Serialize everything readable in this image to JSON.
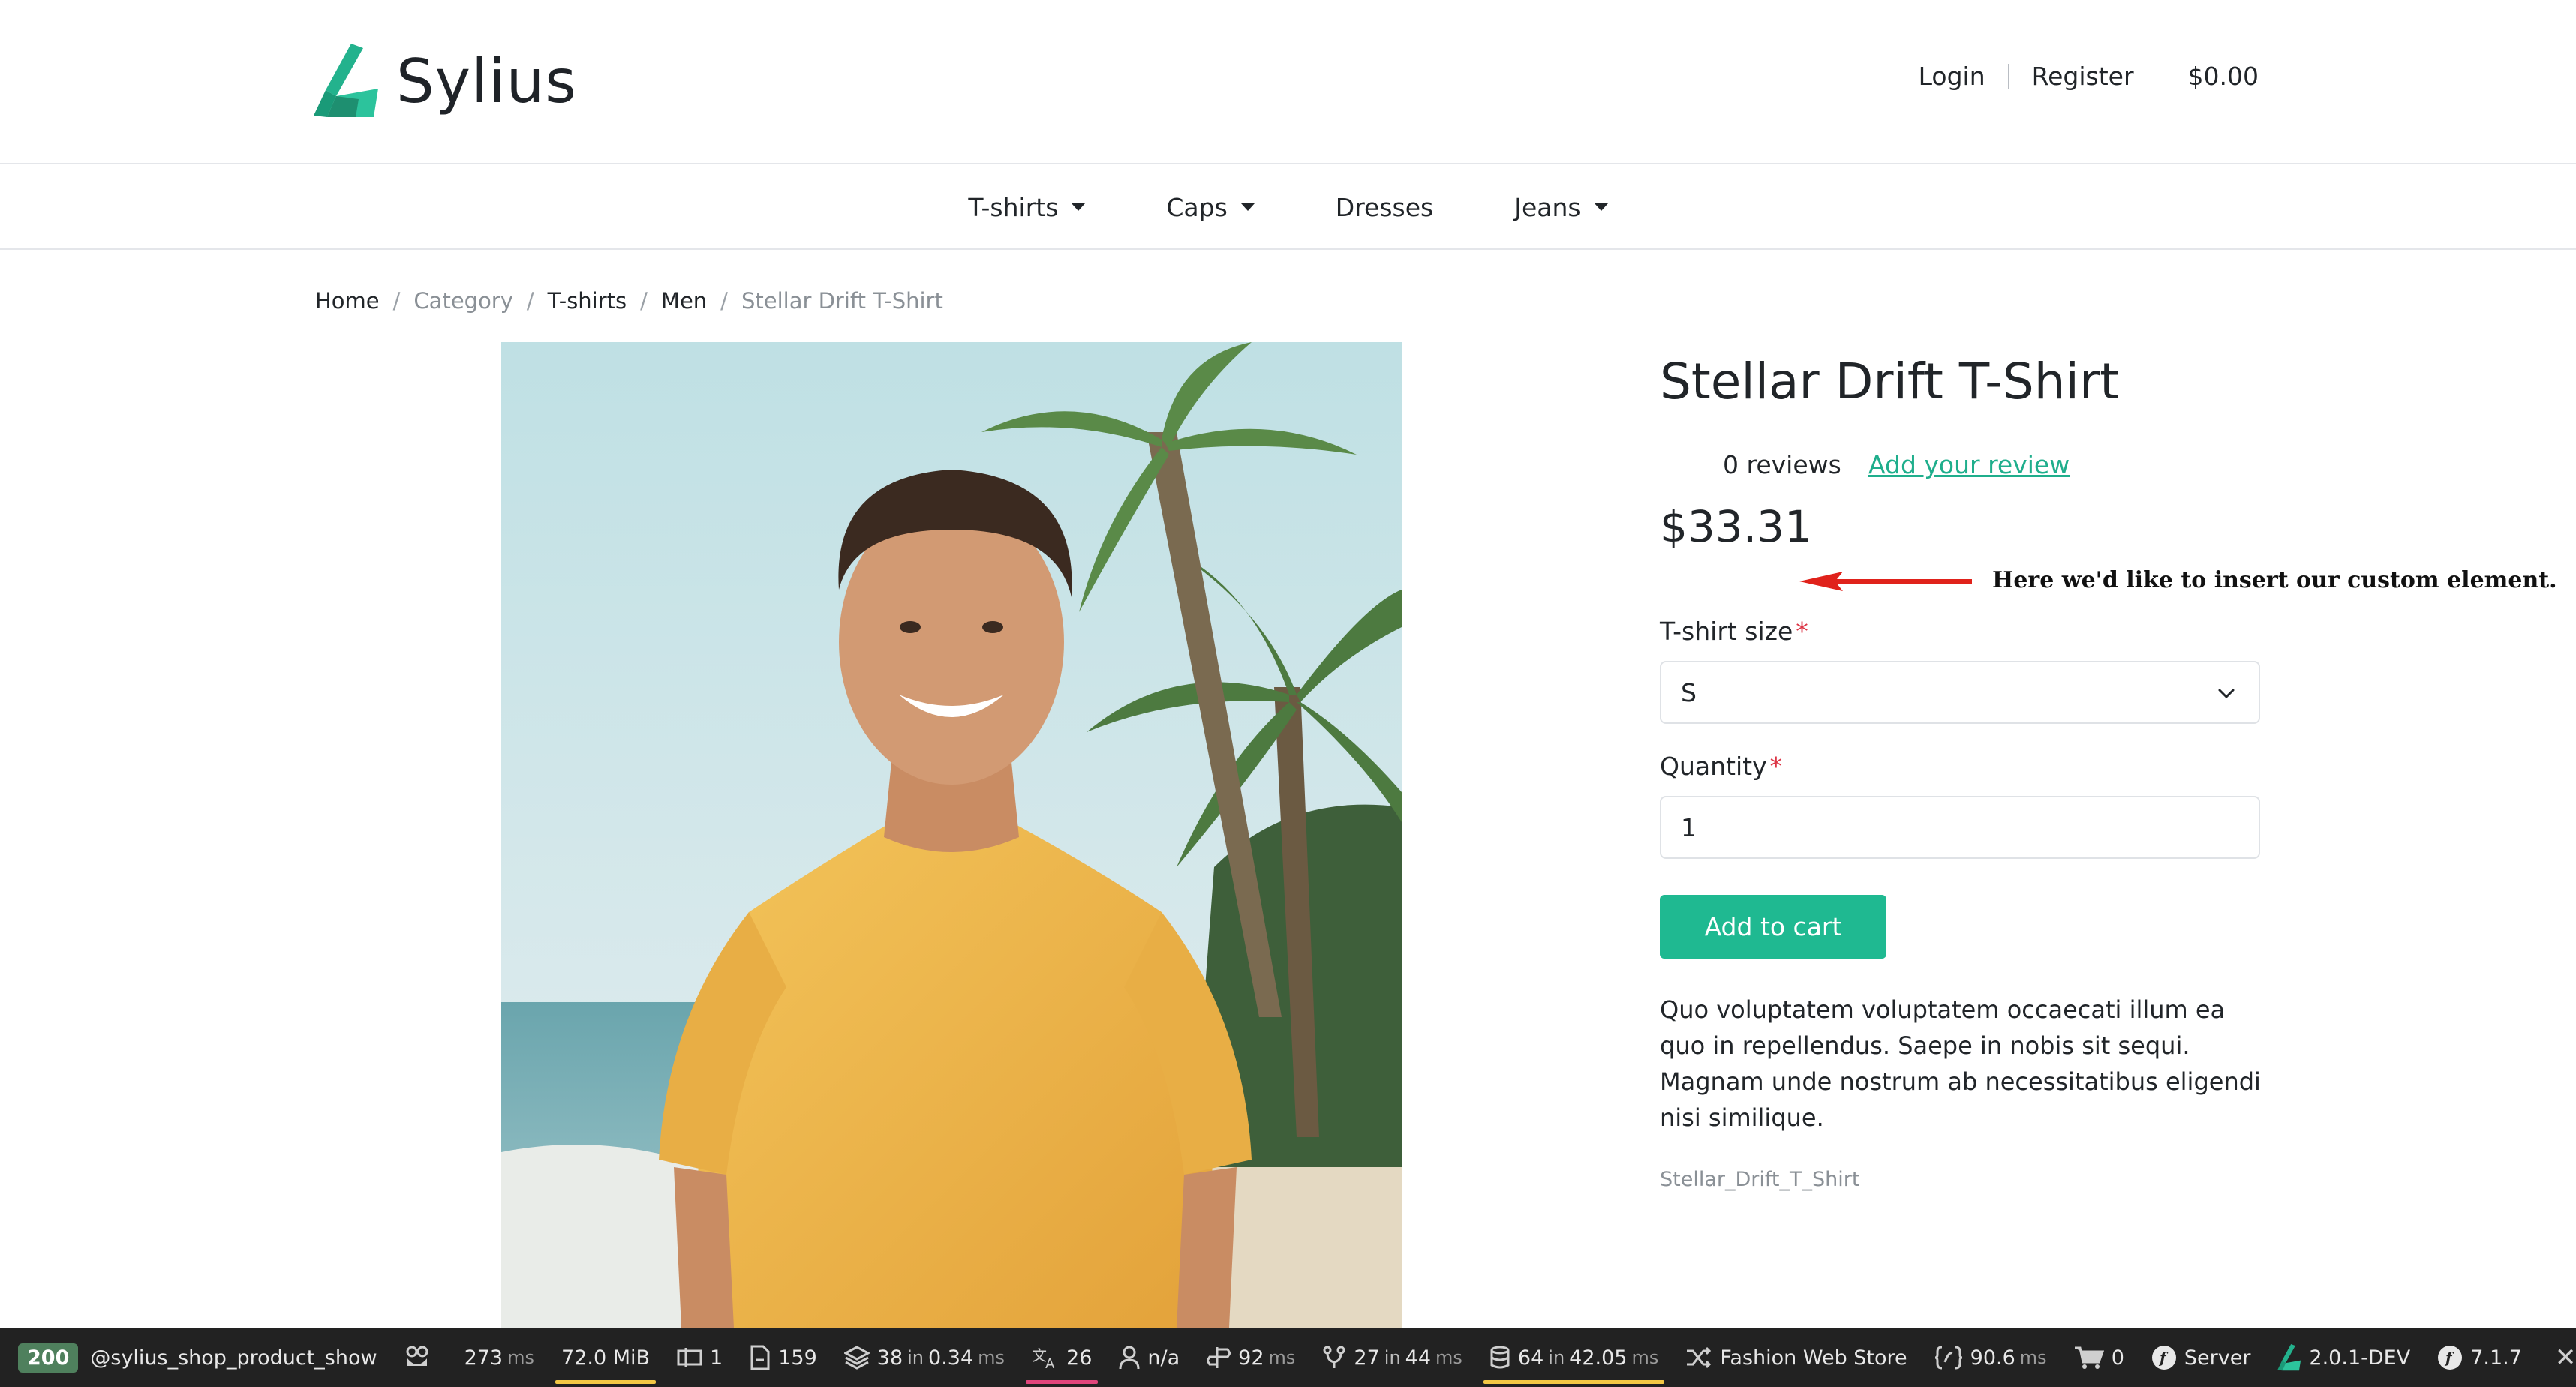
{
  "header": {
    "logo_text": "Sylius",
    "login": "Login",
    "register": "Register",
    "cart_total": "$0.00"
  },
  "nav": {
    "items": [
      {
        "label": "T-shirts",
        "has_dropdown": true
      },
      {
        "label": "Caps",
        "has_dropdown": true
      },
      {
        "label": "Dresses",
        "has_dropdown": false
      },
      {
        "label": "Jeans",
        "has_dropdown": true
      }
    ]
  },
  "breadcrumb": {
    "items": [
      "Home",
      "Category",
      "T-shirts",
      "Men",
      "Stellar Drift T-Shirt"
    ],
    "separator": "/"
  },
  "product": {
    "title": "Stellar Drift T-Shirt",
    "reviews": "0 reviews",
    "add_review": "Add your review",
    "price": "$33.31",
    "size_label": "T-shirt size",
    "size_value": "S",
    "quantity_label": "Quantity",
    "quantity_value": "1",
    "required_mark": "*",
    "add_to_cart": "Add to cart",
    "description": "Quo voluptatem voluptatem occaecati illum ea quo in repellendus. Saepe in nobis sit sequi. Magnam unde nostrum ab necessitatibus eligendi nisi similique.",
    "code": "Stellar_Drift_T_Shirt"
  },
  "annotation": {
    "text": "Here we'd like to insert our custom element."
  },
  "toolbar": {
    "status_code": "200",
    "route": "@sylius_shop_product_show",
    "time_value": "273",
    "time_unit": "ms",
    "memory": "72.0 MiB",
    "forms": "1",
    "requests": "159",
    "cache_count": "38",
    "cache_in": "in",
    "cache_time": "0.34",
    "cache_unit": "ms",
    "translations": "26",
    "user": "n/a",
    "events_time": "92",
    "events_unit": "ms",
    "workflow_count": "27",
    "workflow_in": "in",
    "workflow_time": "44",
    "workflow_unit": "ms",
    "db_queries": "64",
    "db_in": "in",
    "db_time": "42.05",
    "db_unit": "ms",
    "channel": "Fashion Web Store",
    "twig_time": "90.6",
    "twig_unit": "ms",
    "cart_items": "0",
    "server": "Server",
    "sylius_version": "2.0.1-DEV",
    "symfony_version": "7.1.7",
    "close": "✕"
  },
  "colors": {
    "accent": "#1fb991",
    "link": "#1fae8c",
    "required": "#dc3545",
    "toolbar_bg": "#222222",
    "status_badge": "#4f805d",
    "annotation_arrow": "#e0221b"
  }
}
